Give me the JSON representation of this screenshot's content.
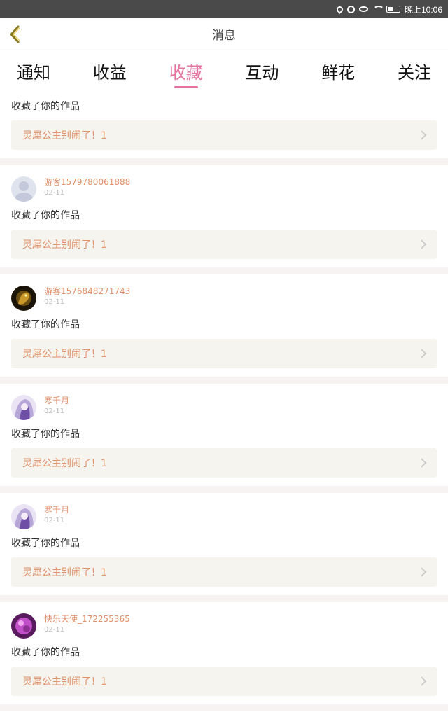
{
  "status_bar": {
    "time": "晚上10:06"
  },
  "header": {
    "title": "消息"
  },
  "tabs": [
    {
      "label": "通知"
    },
    {
      "label": "收益"
    },
    {
      "label": "收藏",
      "active": true
    },
    {
      "label": "互动"
    },
    {
      "label": "鲜花"
    },
    {
      "label": "关注"
    }
  ],
  "items": [
    {
      "action": "收藏了你的作品",
      "work": "灵犀公主别闹了！1"
    },
    {
      "username": "游客1579780061888",
      "date": "02-11",
      "avatar": "default-avatar",
      "action": "收藏了你的作品",
      "work": "灵犀公主别闹了！1"
    },
    {
      "username": "游客1576848271743",
      "date": "02-11",
      "avatar": "dragon-avatar",
      "action": "收藏了你的作品",
      "work": "灵犀公主别闹了！1"
    },
    {
      "username": "寒千月",
      "date": "02-11",
      "avatar": "anime-girl-avatar",
      "action": "收藏了你的作品",
      "work": "灵犀公主别闹了！1"
    },
    {
      "username": "寒千月",
      "date": "02-11",
      "avatar": "anime-girl-avatar",
      "action": "收藏了你的作品",
      "work": "灵犀公主别闹了！1"
    },
    {
      "username": "快乐天使_172255365",
      "date": "02-11",
      "avatar": "purple-avatar",
      "action": "收藏了你的作品",
      "work": "灵犀公主别闹了！1"
    }
  ],
  "colors": {
    "accent": "#e4739f",
    "username": "#e0916a",
    "card_bg": "#f5f4ee",
    "separator": "#f7f3f3"
  }
}
